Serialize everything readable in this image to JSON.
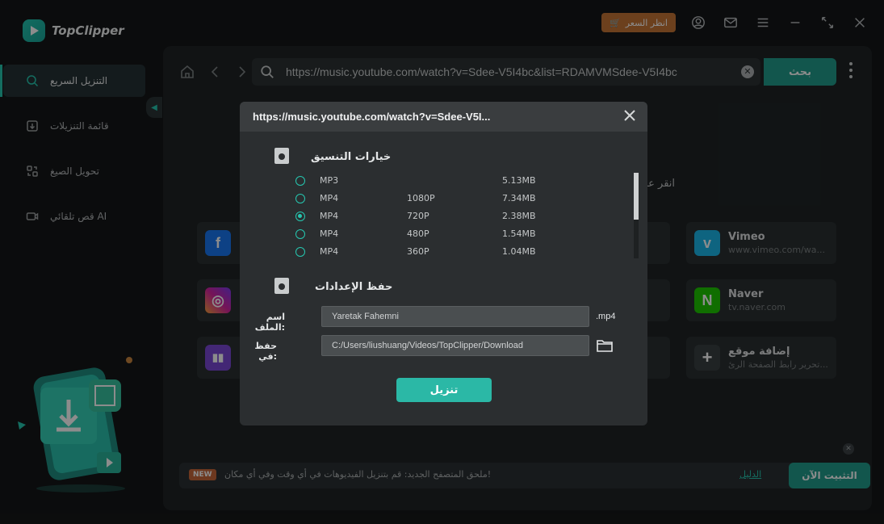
{
  "app": {
    "name": "TopClipper"
  },
  "topbar": {
    "price_label": "انظر السعر"
  },
  "sidebar": {
    "items": [
      {
        "label": "التنزيل السريع",
        "icon": "search-icon"
      },
      {
        "label": "قائمة التنزيلات",
        "icon": "download-list-icon"
      },
      {
        "label": "تحويل الصيغ",
        "icon": "convert-icon"
      },
      {
        "label": "قص تلقائي AI",
        "icon": "ai-cut-icon"
      }
    ]
  },
  "toolbar": {
    "url": "https://music.youtube.com/watch?v=Sdee-V5I4bc&list=RDAMVMSdee-V5I4bc",
    "search_label": "بحث"
  },
  "main": {
    "hint": "انقر على",
    "cards": {
      "vimeo": {
        "title": "Vimeo",
        "sub": "www.vimeo.com/wa...",
        "color": "#1ab7ea"
      },
      "naver": {
        "title": "Naver",
        "sub": "tv.naver.com",
        "color": "#1ec800"
      },
      "add_site": {
        "title": "إضافة موقع",
        "sub": "تحرير رابط الصفحة الرئ..."
      }
    }
  },
  "banner": {
    "badge": "NEW",
    "text": "ملحق المتصفح الجديد: قم بتنزيل الفيديوهات في أي وقت وفي أي مكان!",
    "guide_link": "الدليل",
    "install_label": "التثبيت الآن"
  },
  "modal": {
    "title": "https://music.youtube.com/watch?v=Sdee-V5I...",
    "format_section_title": "خيارات التنسيق",
    "formats": [
      {
        "format": "MP3",
        "quality": "",
        "size": "5.13MB",
        "selected": false
      },
      {
        "format": "MP4",
        "quality": "1080P",
        "size": "7.34MB",
        "selected": false
      },
      {
        "format": "MP4",
        "quality": "720P",
        "size": "2.38MB",
        "selected": true
      },
      {
        "format": "MP4",
        "quality": "480P",
        "size": "1.54MB",
        "selected": false
      },
      {
        "format": "MP4",
        "quality": "360P",
        "size": "1.04MB",
        "selected": false
      }
    ],
    "save_section_title": "حفظ الإعدادات",
    "filename_label": "اسم الملف:",
    "filename_value": "Yaretak Fahemni",
    "extension": ".mp4",
    "save_in_label": "حفظ في:",
    "save_path": "C:/Users/liushuang/Videos/TopClipper/Download",
    "download_label": "تنزيل"
  },
  "colors": {
    "accent": "#26c7b0",
    "button": "#229d8c",
    "price": "#c57636"
  }
}
